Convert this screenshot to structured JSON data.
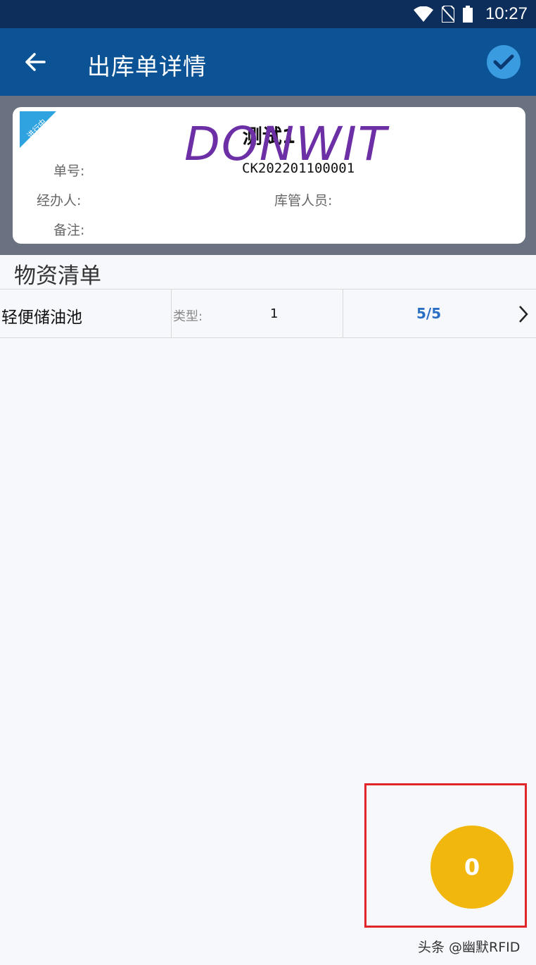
{
  "status_bar": {
    "time": "10:27"
  },
  "app_bar": {
    "title": "出库单详情"
  },
  "order": {
    "status_tag": "进行中",
    "name": "测试1",
    "watermark": "DONWIT",
    "order_no_label": "单号:",
    "order_no": "CK202201100001",
    "handler_label": "经办人:",
    "handler_value": "",
    "keeper_label": "库管人员:",
    "keeper_value": "",
    "remark_label": "备注:",
    "remark_value": ""
  },
  "materials": {
    "title": "物资清单",
    "items": [
      {
        "name": "轻便储油池",
        "type_label": "类型:",
        "type_value": "1",
        "quantity": "5/5"
      }
    ]
  },
  "fab": {
    "count": "0"
  },
  "footer": {
    "credit": "头条 @幽默RFID"
  },
  "colors": {
    "status_bar": "#0d2d5a",
    "app_bar": "#0b5394",
    "accent": "#3a9be0",
    "fab": "#f2b70c",
    "highlight": "#e0262a",
    "quantity": "#2a6fc4"
  }
}
